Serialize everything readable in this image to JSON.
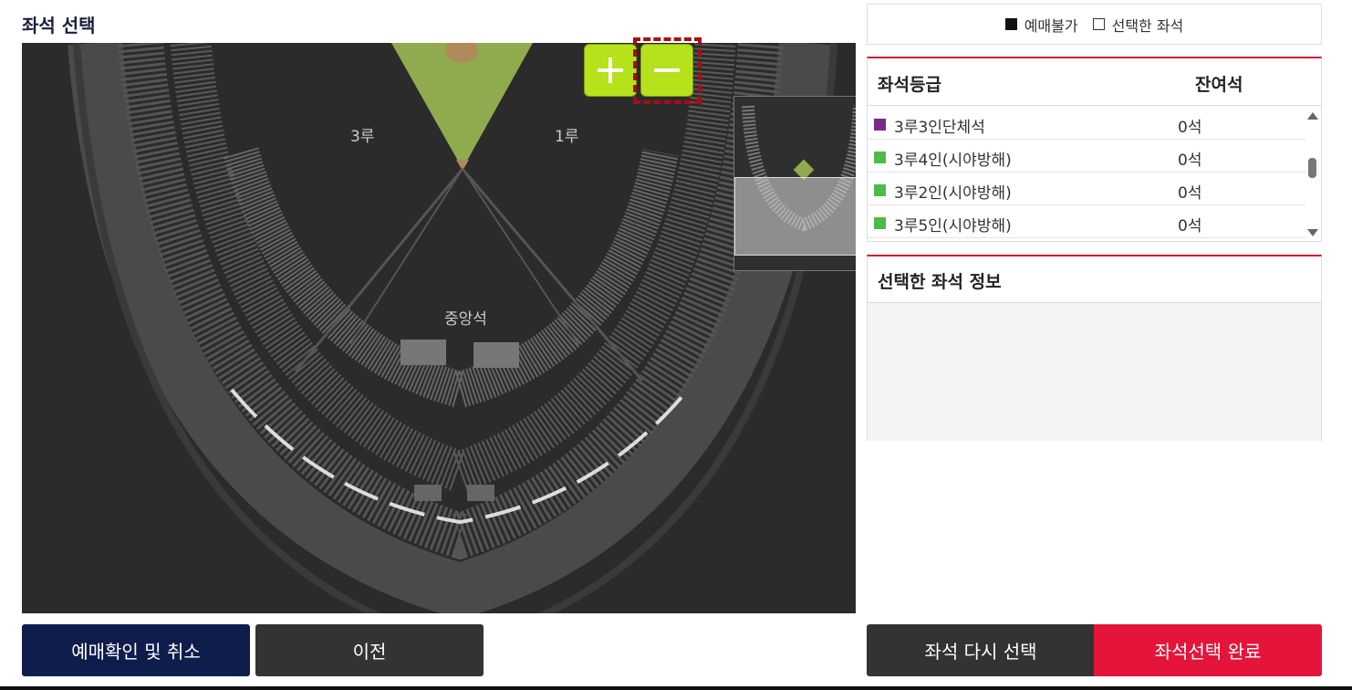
{
  "header": {
    "title": "좌석 선택"
  },
  "map": {
    "labels": {
      "third_base": "3루",
      "first_base": "1루",
      "center": "중앙석"
    },
    "zoom_in_icon": "plus-icon",
    "zoom_out_icon": "minus-icon"
  },
  "legend": {
    "unavailable": "예매불가",
    "selected": "선택한 좌석"
  },
  "grades": {
    "col_grade": "좌석등급",
    "col_remaining": "잔여석",
    "items": [
      {
        "name": "3루3인단체석",
        "count": "0석",
        "color": "#7b2a8a"
      },
      {
        "name": "3루4인(시야방해)",
        "count": "0석",
        "color": "#4cbb4a"
      },
      {
        "name": "3루2인(시야방해)",
        "count": "0석",
        "color": "#4cbb4a"
      },
      {
        "name": "3루5인(시야방해)",
        "count": "0석",
        "color": "#4cbb4a"
      }
    ]
  },
  "selected_info": {
    "title": "선택한 좌석 정보"
  },
  "buttons": {
    "confirm_cancel": "예매확인 및 취소",
    "previous": "이전",
    "reselect": "좌석 다시 선택",
    "complete": "좌석선택 완료"
  },
  "colors": {
    "accent": "#e4143a",
    "navy": "#0f1d4d",
    "zoom": "#b6e21c"
  }
}
